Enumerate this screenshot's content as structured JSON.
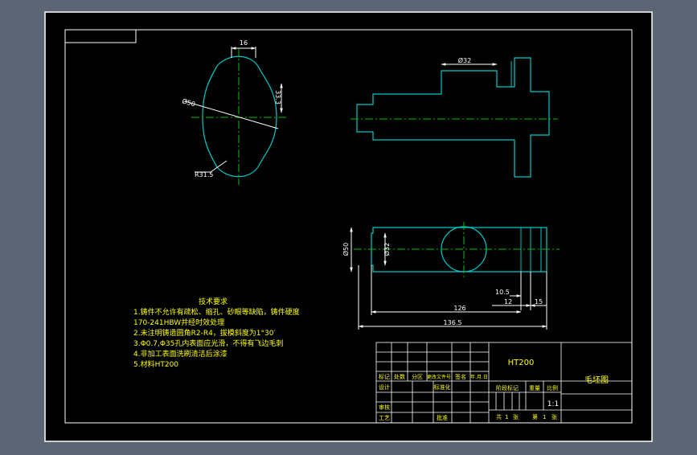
{
  "drawing": {
    "colors": {
      "background": "#5b6574",
      "sheet": "#000000",
      "frame": "#ffffff",
      "outline": "#00c8c8",
      "centerline": "#00c000",
      "dimension": "#ffffff",
      "yellow_text": "#ffff00"
    },
    "dimensions": {
      "left_view": {
        "width_top": "16",
        "height_right": "33.3",
        "diameter": "Ø50",
        "radius": "R31.5"
      },
      "front_view": {
        "diameter_top": "Ø32"
      },
      "bottom_view": {
        "dia_outer": "Ø50",
        "dia_inner": "Ø32",
        "d_10_5": "10.5",
        "d_12": "12",
        "d_15": "15",
        "d_126": "126",
        "d_136_5": "136.5"
      }
    },
    "notes": {
      "title": "技术要求",
      "items": [
        "1.铸件不允许有疏松、缩孔、砂眼等缺陷，铸件硬度",
        "170-241HBW并经时效处理",
        "2.未注明铸造圆角R2-R4，拔模斜度为1°30′",
        "3.Φ0.7,Φ35孔内表面应光滑，不得有飞边毛刺",
        "4.非加工表面洗刷清洁后涂漆",
        "5.材料HT200"
      ]
    },
    "title_block": {
      "material": "HT200",
      "drawing_name": "毛坯图",
      "header_row": [
        "标记",
        "处数",
        "分区",
        "更改文件号",
        "签名",
        "年.月.日"
      ],
      "label_design": "设计",
      "label_standard": "标准化",
      "label_review": "审核",
      "label_process": "工艺",
      "label_approve": "批准",
      "label_stage": "阶段标记",
      "label_weight": "重量",
      "label_scale": "比例",
      "scale": "1:1",
      "sheet_total_prefix": "共",
      "sheet_total": "1",
      "sheet_total_suffix": "张",
      "sheet_index_prefix": "第",
      "sheet_index": "1",
      "sheet_index_suffix": "张"
    }
  }
}
